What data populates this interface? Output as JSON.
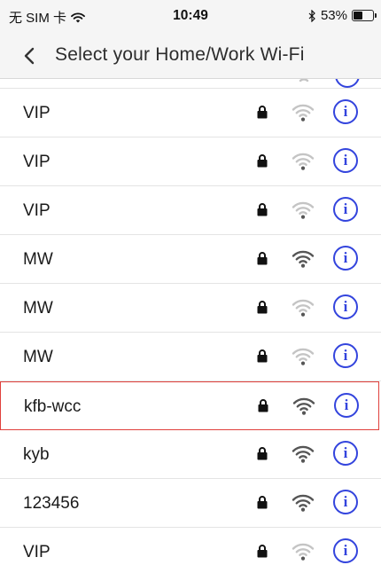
{
  "status_bar": {
    "carrier": "无 SIM 卡",
    "time": "10:49",
    "battery_percent": "53%",
    "battery_level": 0.53,
    "wifi_icon": "wifi-icon",
    "bluetooth_icon": "bluetooth-icon"
  },
  "nav": {
    "back_icon": "chevron-left-icon",
    "title": "Select your Home/Work Wi-Fi"
  },
  "colors": {
    "accent": "#3344dd",
    "highlight_border": "#e0403c",
    "signal_strong": "#555555",
    "signal_weak": "#c4c4c4"
  },
  "networks": [
    {
      "name": "VIP",
      "secured": true,
      "signal": "weak"
    },
    {
      "name": "VIP",
      "secured": true,
      "signal": "weak"
    },
    {
      "name": "VIP",
      "secured": true,
      "signal": "weak"
    },
    {
      "name": "MW",
      "secured": true,
      "signal": "strong"
    },
    {
      "name": "MW",
      "secured": true,
      "signal": "weak"
    },
    {
      "name": "MW",
      "secured": true,
      "signal": "weak"
    },
    {
      "name": "kfb-wcc",
      "secured": true,
      "signal": "strong",
      "highlighted": true
    },
    {
      "name": "kyb",
      "secured": true,
      "signal": "strong"
    },
    {
      "name": "123456",
      "secured": true,
      "signal": "strong"
    },
    {
      "name": "VIP",
      "secured": true,
      "signal": "weak"
    }
  ],
  "info_glyph": "i"
}
